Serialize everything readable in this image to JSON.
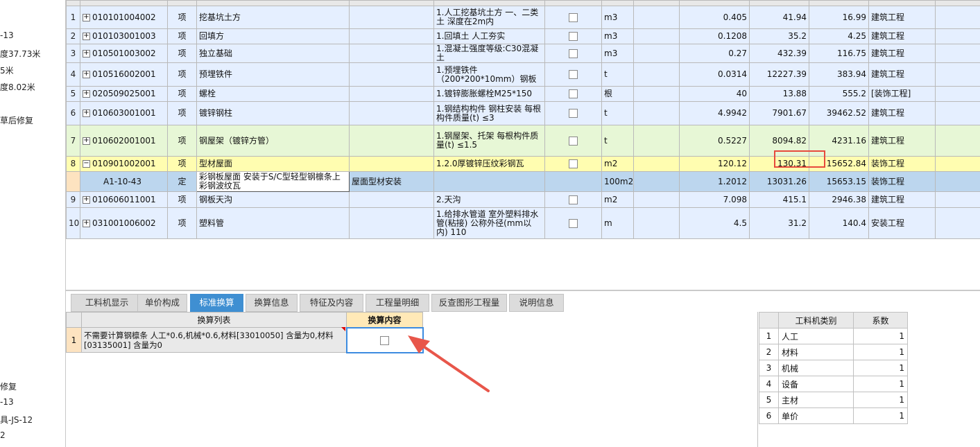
{
  "left_panel": {
    "lines": [
      "-13",
      "度37.73米",
      "5米",
      "度8.02米",
      "草后修复",
      "",
      "修复",
      "-13",
      "具-JS-12",
      "2"
    ]
  },
  "grid": {
    "rows": [
      {
        "no": "1",
        "code": "010101004002",
        "type": "项",
        "name": "挖基坑土方",
        "feature": "1.人工挖基坑土方 一、二类土 深度在2m内",
        "unit": "m3",
        "qty": "0.405",
        "price": "41.94",
        "total": "16.99",
        "category": "建筑工程"
      },
      {
        "no": "2",
        "code": "010103001003",
        "type": "项",
        "name": "回填方",
        "feature": "1.回填土 人工夯实",
        "unit": "m3",
        "qty": "0.1208",
        "price": "35.2",
        "total": "4.25",
        "category": "建筑工程"
      },
      {
        "no": "3",
        "code": "010501003002",
        "type": "项",
        "name": "独立基础",
        "feature": "1.混凝土强度等级:C30混凝土",
        "unit": "m3",
        "qty": "0.27",
        "price": "432.39",
        "total": "116.75",
        "category": "建筑工程"
      },
      {
        "no": "4",
        "code": "010516002001",
        "type": "项",
        "name": "预埋铁件",
        "feature": "1.预埋铁件（200*200*10mm）钢板",
        "unit": "t",
        "qty": "0.0314",
        "price": "12227.39",
        "total": "383.94",
        "category": "建筑工程"
      },
      {
        "no": "5",
        "code": "020509025001",
        "type": "项",
        "name": "螺栓",
        "feature": "1.镀锌膨胀螺栓M25*150",
        "unit": "根",
        "qty": "40",
        "price": "13.88",
        "total": "555.2",
        "category": "[装饰工程]"
      },
      {
        "no": "6",
        "code": "010603001001",
        "type": "项",
        "name": "镀锌钢柱",
        "feature": "1.钢结构构件 钢柱安装 每根构件质量(t) ≤3",
        "unit": "t",
        "qty": "4.9942",
        "price": "7901.67",
        "total": "39462.52",
        "category": "建筑工程"
      },
      {
        "no": "7",
        "code": "010602001001",
        "type": "项",
        "name": "钢屋架（镀锌方管）",
        "feature": "1.钢屋架、托架 每根构件质量(t) ≤1.5",
        "unit": "t",
        "qty": "0.5227",
        "price": "8094.82",
        "total": "4231.16",
        "category": "建筑工程"
      },
      {
        "no": "8",
        "code": "010901002001",
        "type": "项",
        "name": "型材屋面",
        "feature": "1.2.0厚镀锌压纹彩钢瓦",
        "unit": "m2",
        "qty": "120.12",
        "price": "130.31",
        "total": "15652.84",
        "category": "装饰工程"
      },
      {
        "no": "",
        "code": "A1-10-43",
        "type": "定",
        "name": "彩钢板屋面 安装于S/C型轻型钢檩条上 彩钢波纹瓦",
        "extra": "屋面型材安装",
        "feature": "",
        "unit": "100m2",
        "qty": "1.2012",
        "price": "13031.26",
        "total": "15653.15",
        "category": "装饰工程"
      },
      {
        "no": "9",
        "code": "010606011001",
        "type": "项",
        "name": "钢板天沟",
        "feature": "2.天沟",
        "unit": "m2",
        "qty": "7.098",
        "price": "415.1",
        "total": "2946.38",
        "category": "建筑工程"
      },
      {
        "no": "10",
        "code": "031001006002",
        "type": "项",
        "name": "塑料管",
        "feature": "1.给排水管道 室外塑料排水管(粘接) 公称外径(mm以内) 110",
        "unit": "m",
        "qty": "4.5",
        "price": "31.2",
        "total": "140.4",
        "category": "安装工程"
      }
    ]
  },
  "tabs": [
    "工料机显示",
    "单价构成",
    "标准换算",
    "换算信息",
    "特征及内容",
    "工程量明细",
    "反查图形工程量",
    "说明信息"
  ],
  "active_tab": "标准换算",
  "calc": {
    "header_list": "换算列表",
    "header_content": "换算内容",
    "row_no": "1",
    "row_text": "不需要计算钢檩条 人工*0.6,机械*0.6,材料[33010050] 含量为0,材料[03135001] 含量为0"
  },
  "coef": {
    "header_type": "工料机类别",
    "header_coef": "系数",
    "rows": [
      {
        "no": "1",
        "type": "人工",
        "coef": "1"
      },
      {
        "no": "2",
        "type": "材料",
        "coef": "1"
      },
      {
        "no": "3",
        "type": "机械",
        "coef": "1"
      },
      {
        "no": "4",
        "type": "设备",
        "coef": "1"
      },
      {
        "no": "5",
        "type": "主材",
        "coef": "1"
      },
      {
        "no": "6",
        "type": "单价",
        "coef": "1"
      }
    ]
  },
  "colors": {
    "accent": "#3f8fd2",
    "highlight_box": "#e74a3c",
    "arrow": "#e8564a"
  }
}
